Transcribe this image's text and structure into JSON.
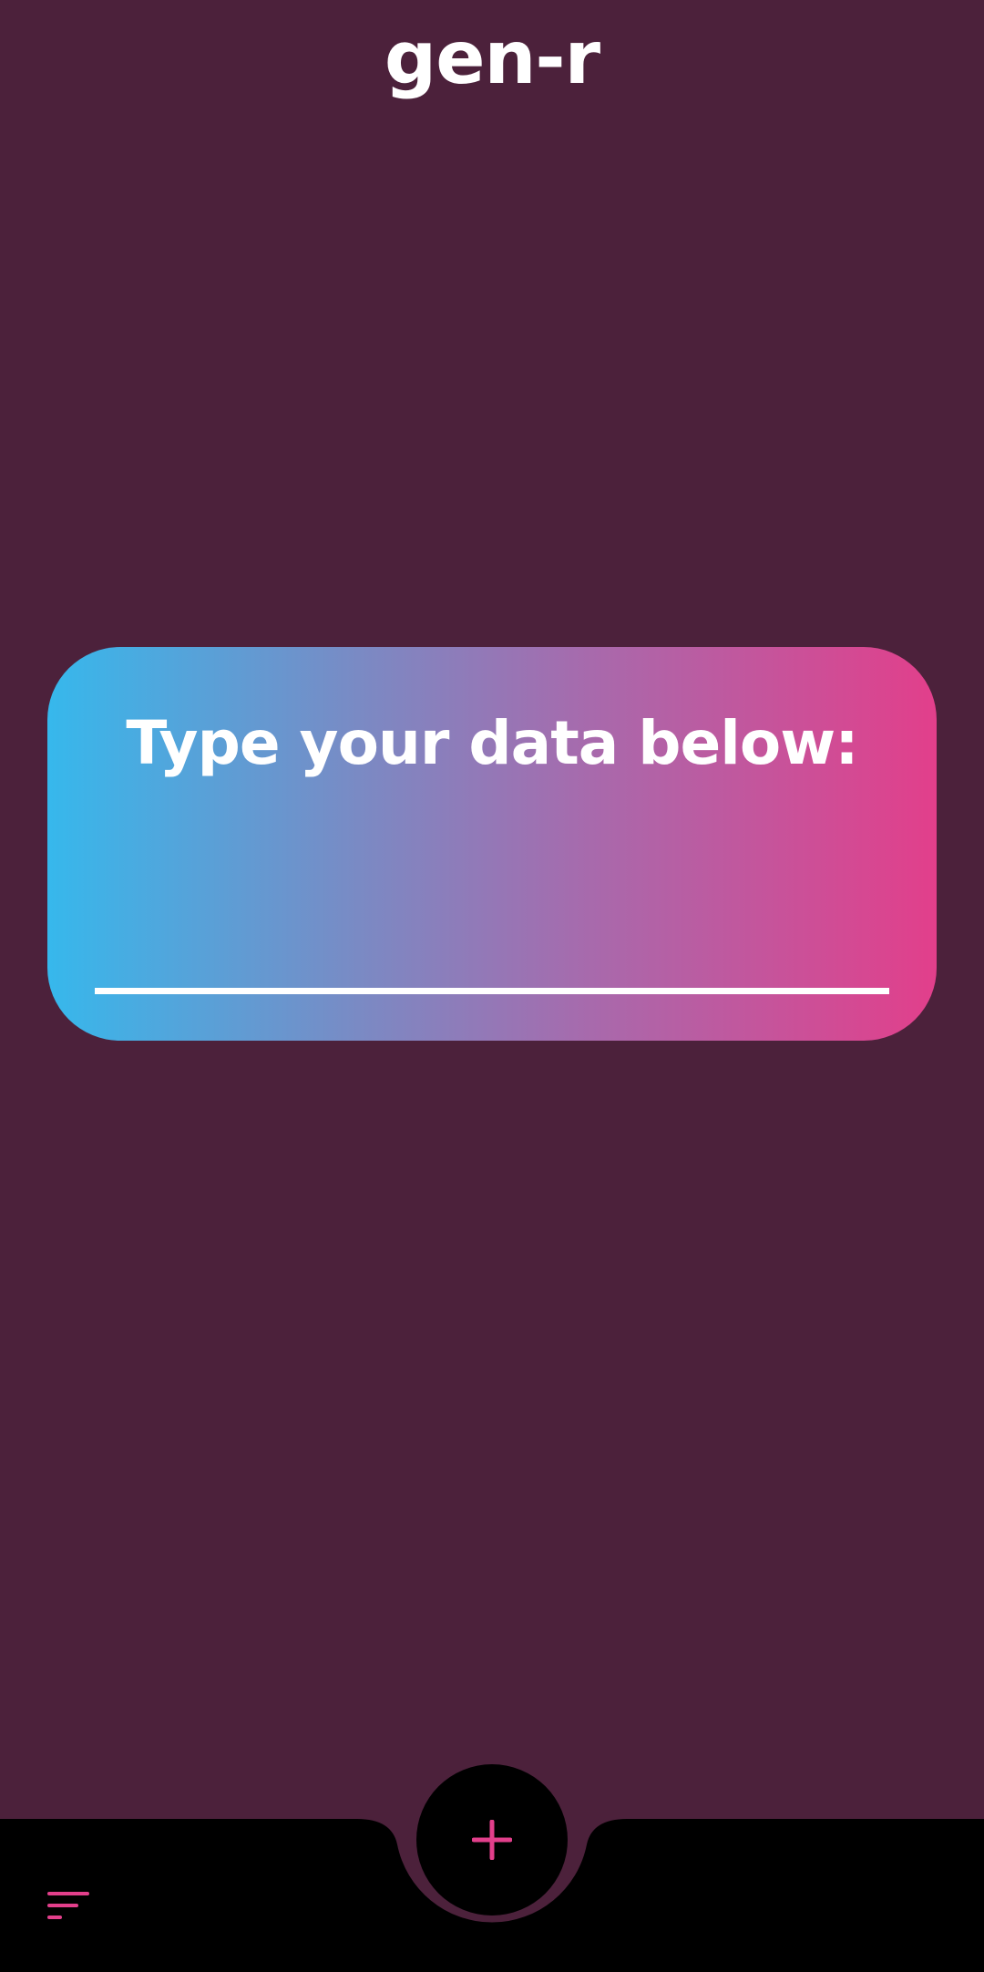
{
  "app": {
    "title": "gen-r"
  },
  "card": {
    "title": "Type your data below:",
    "input_value": "",
    "input_placeholder": ""
  },
  "bottom_bar": {
    "fab_icon": "plus-icon",
    "menu_icon": "sort-menu-icon"
  },
  "colors": {
    "background": "#4c213b",
    "accent": "#e23f8b",
    "gradient_start": "#36b8ec",
    "gradient_end": "#e23f8b",
    "bar": "#000000",
    "text": "#ffffff"
  }
}
